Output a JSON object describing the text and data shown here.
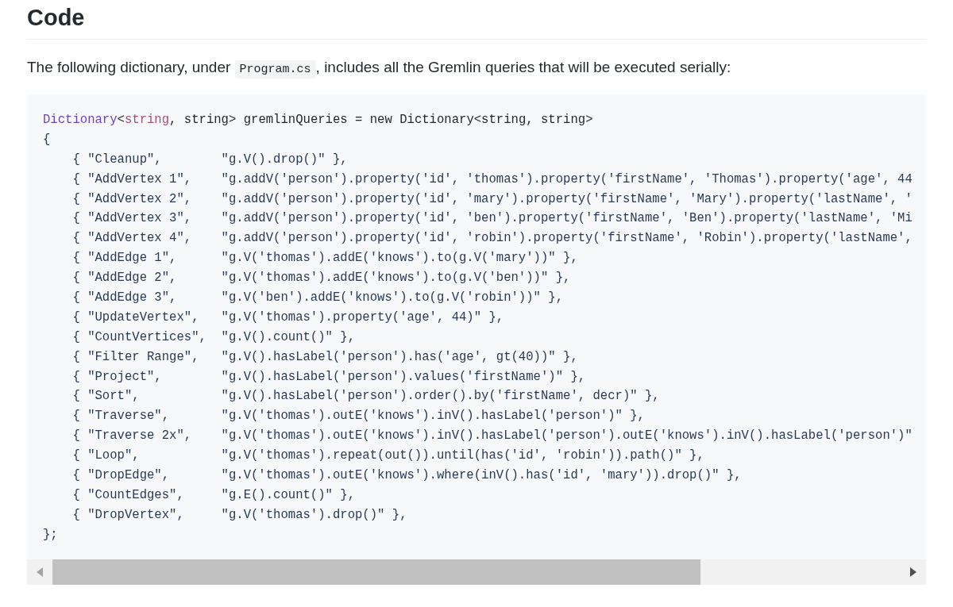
{
  "heading": "Code",
  "intro": {
    "before": "The following dictionary, under ",
    "code": "Program.cs",
    "after": ", includes all the Gremlin queries that will be executed serially:"
  },
  "code": {
    "header": [
      {
        "text": "Dictionary",
        "kind": "type"
      },
      {
        "text": "<",
        "kind": "plain"
      },
      {
        "text": "string",
        "kind": "keyword"
      },
      {
        "text": ", string> gremlinQueries = new Dictionary<string, string>",
        "kind": "plain"
      }
    ],
    "open": "{",
    "entries": [
      {
        "key": "{ \"Cleanup\",",
        "value": "\"g.V().drop()\" },"
      },
      {
        "key": "{ \"AddVertex 1\",",
        "value": "\"g.addV('person').property('id', 'thomas').property('firstName', 'Thomas').property('age', 44"
      },
      {
        "key": "{ \"AddVertex 2\",",
        "value": "\"g.addV('person').property('id', 'mary').property('firstName', 'Mary').property('lastName', '"
      },
      {
        "key": "{ \"AddVertex 3\",",
        "value": "\"g.addV('person').property('id', 'ben').property('firstName', 'Ben').property('lastName', 'Mi"
      },
      {
        "key": "{ \"AddVertex 4\",",
        "value": "\"g.addV('person').property('id', 'robin').property('firstName', 'Robin').property('lastName',"
      },
      {
        "key": "{ \"AddEdge 1\",",
        "value": "\"g.V('thomas').addE('knows').to(g.V('mary'))\" },"
      },
      {
        "key": "{ \"AddEdge 2\",",
        "value": "\"g.V('thomas').addE('knows').to(g.V('ben'))\" },"
      },
      {
        "key": "{ \"AddEdge 3\",",
        "value": "\"g.V('ben').addE('knows').to(g.V('robin'))\" },"
      },
      {
        "key": "{ \"UpdateVertex\",",
        "value": "\"g.V('thomas').property('age', 44)\" },"
      },
      {
        "key": "{ \"CountVertices\",",
        "value": "\"g.V().count()\" },"
      },
      {
        "key": "{ \"Filter Range\",",
        "value": "\"g.V().hasLabel('person').has('age', gt(40))\" },"
      },
      {
        "key": "{ \"Project\",",
        "value": "\"g.V().hasLabel('person').values('firstName')\" },"
      },
      {
        "key": "{ \"Sort\",",
        "value": "\"g.V().hasLabel('person').order().by('firstName', decr)\" },"
      },
      {
        "key": "{ \"Traverse\",",
        "value": "\"g.V('thomas').outE('knows').inV().hasLabel('person')\" },"
      },
      {
        "key": "{ \"Traverse 2x\",",
        "value": "\"g.V('thomas').outE('knows').inV().hasLabel('person').outE('knows').inV().hasLabel('person')\""
      },
      {
        "key": "{ \"Loop\",",
        "value": "\"g.V('thomas').repeat(out()).until(has('id', 'robin')).path()\" },"
      },
      {
        "key": "{ \"DropEdge\",",
        "value": "\"g.V('thomas').outE('knows').where(inV().has('id', 'mary')).drop()\" },"
      },
      {
        "key": "{ \"CountEdges\",",
        "value": "\"g.E().count()\" },"
      },
      {
        "key": "{ \"DropVertex\",",
        "value": "\"g.V('thomas').drop()\" },"
      }
    ],
    "close": "};"
  }
}
